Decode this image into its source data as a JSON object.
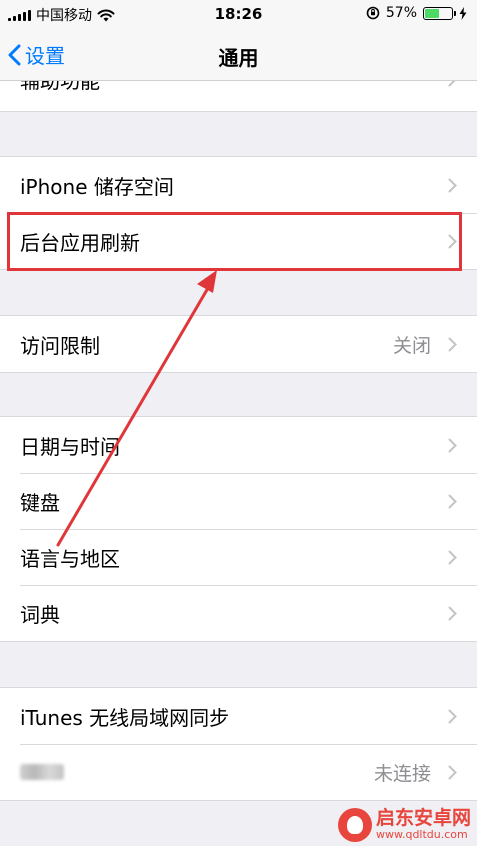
{
  "status_bar": {
    "carrier": "中国移动",
    "time": "18:26",
    "battery_percent": "57%",
    "battery_level": 0.57,
    "battery_color": "#4cd964"
  },
  "nav": {
    "back_label": "设置",
    "title": "通用",
    "accent_color": "#007aff"
  },
  "list": {
    "partial_label": "辅助功能",
    "storage": "iPhone 储存空间",
    "background_refresh": "后台应用刷新",
    "restrictions": "访问限制",
    "restrictions_value": "关闭",
    "date_time": "日期与时间",
    "keyboard": "键盘",
    "language_region": "语言与地区",
    "dictionary": "词典",
    "itunes_sync": "iTunes 无线局域网同步",
    "vpn_value": "未连接"
  },
  "annotation": {
    "color": "#e0363a"
  },
  "watermark": {
    "name": "启东安卓网",
    "url": "www.qdltdu.com"
  }
}
